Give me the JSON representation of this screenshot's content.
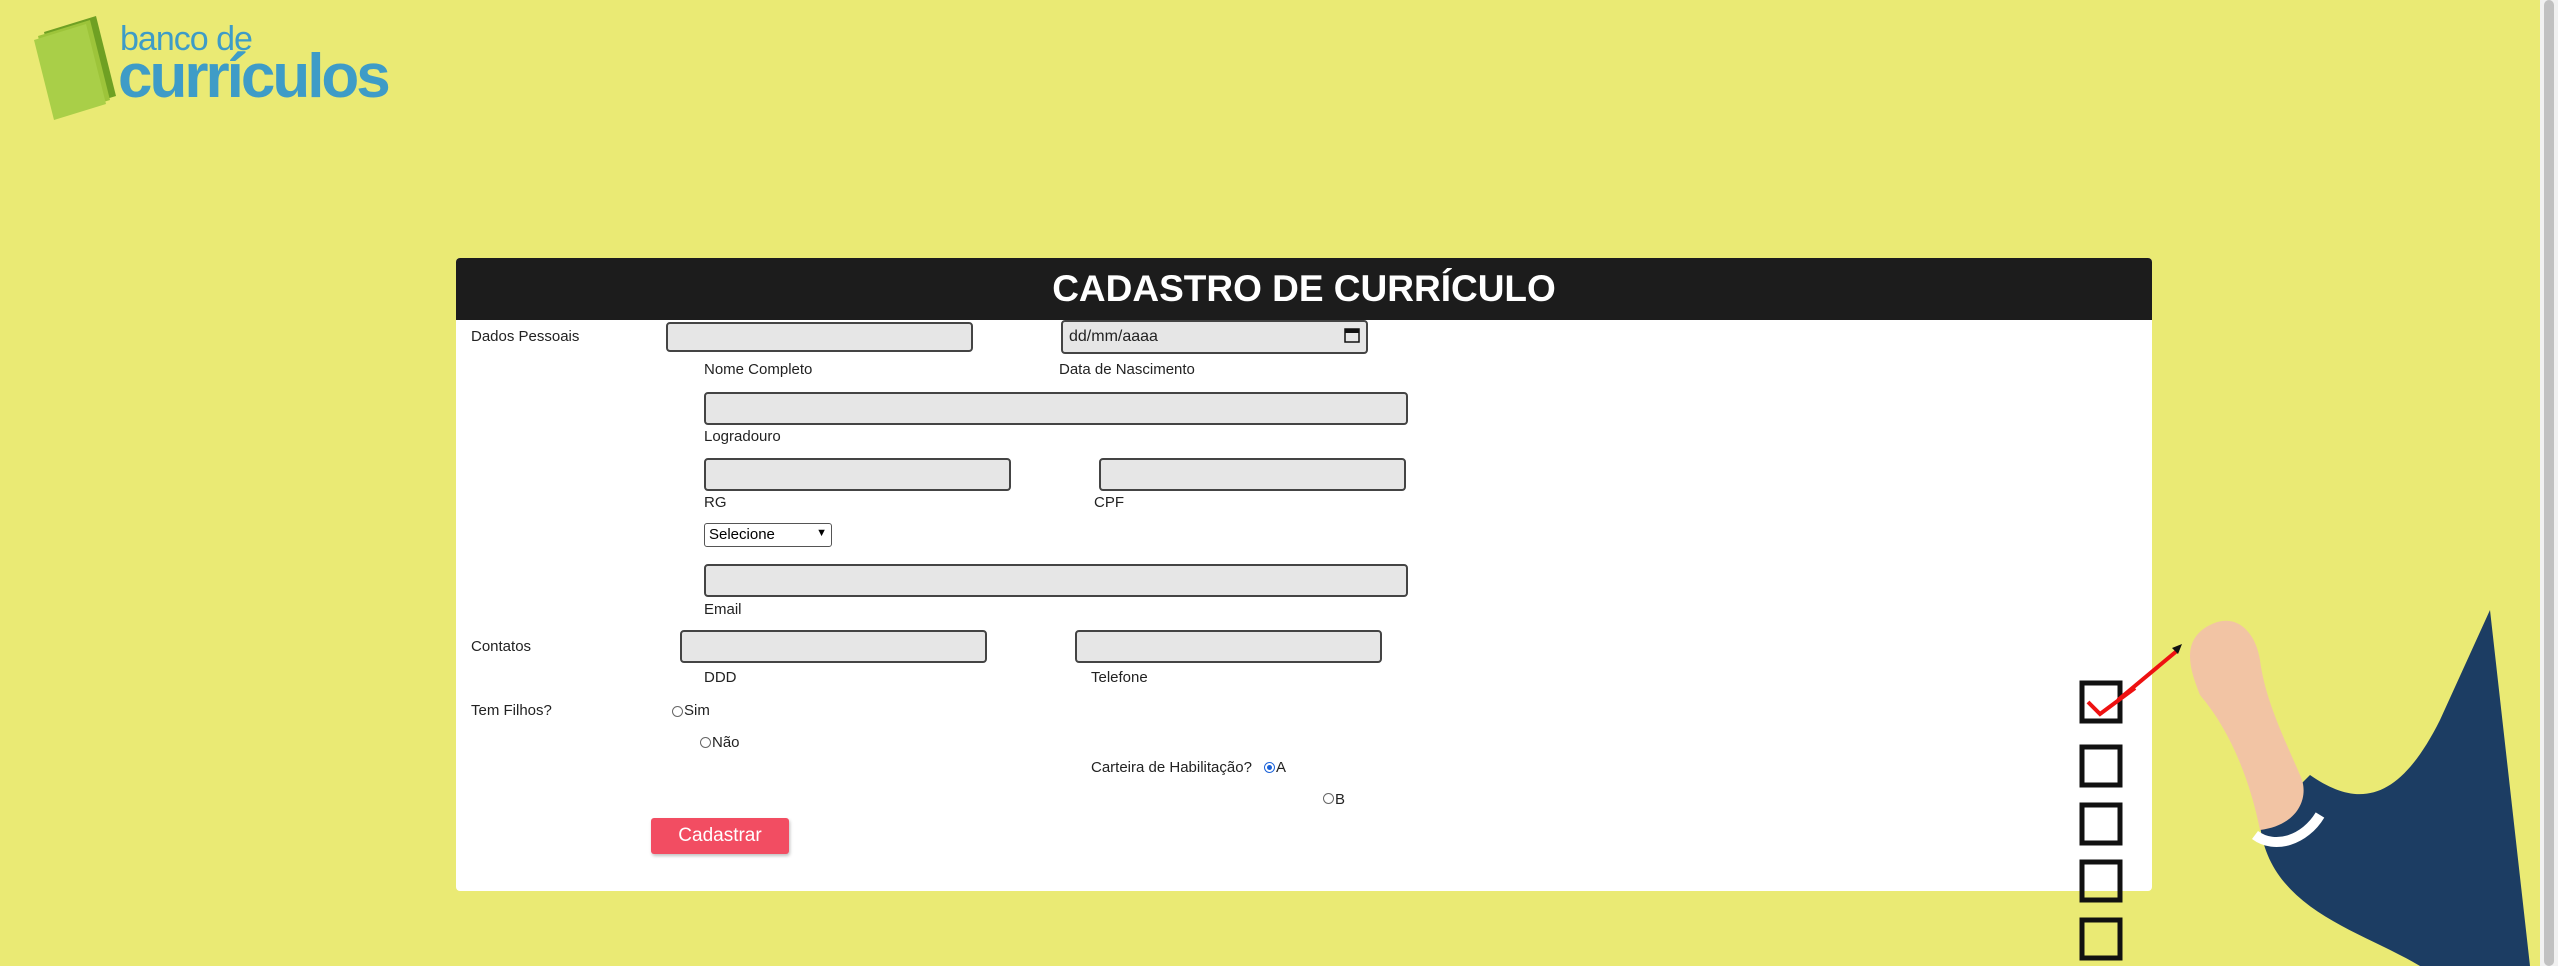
{
  "logo": {
    "line1": "banco de",
    "line2": "currículos",
    "brand_color": "#3e9cc7",
    "accent": "#9dc43a"
  },
  "form": {
    "title": "CADASTRO DE CURRÍCULO",
    "sections": {
      "personal": "Dados Pessoais",
      "contacts": "Contatos",
      "children": "Tem Filhos?"
    },
    "labels": {
      "full_name": "Nome Completo",
      "birth_date": "Data de Nascimento",
      "street": "Logradouro",
      "rg": "RG",
      "cpf": "CPF",
      "email": "Email",
      "ddd": "DDD",
      "phone": "Telefone",
      "license": "Carteira de Habilitação?"
    },
    "date_placeholder": "dd/mm/aaaa",
    "select_value": "Selecione",
    "children_options": [
      "Sim",
      "Não"
    ],
    "license_options": [
      "A",
      "B"
    ],
    "license_selected": "A",
    "submit_label": "Cadastrar"
  },
  "colors": {
    "background": "#eaea74",
    "header": "#1c1c1c",
    "button": "#f24d62"
  }
}
